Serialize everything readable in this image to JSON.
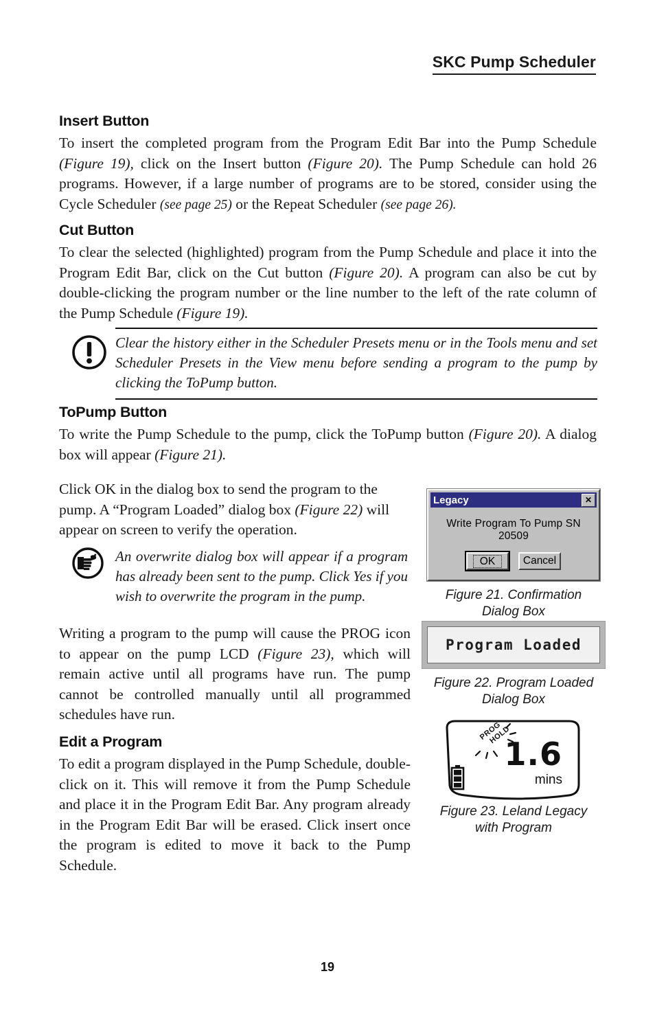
{
  "header": {
    "running_head": "SKC Pump Scheduler"
  },
  "sections": {
    "insert": {
      "heading": "Insert Button",
      "p1_a": "To insert the completed program from the Program Edit Bar into the Pump Schedule ",
      "p1_fig19": "(Figure 19),",
      "p1_b": " click on the Insert button ",
      "p1_fig20": "(Figure 20).",
      "p1_c": " The Pump Schedule can hold 26 programs. However, if a large number of programs are to be stored, consider using the Cycle Scheduler ",
      "p1_page25": "(see page 25)",
      "p1_d": " or the Repeat Scheduler ",
      "p1_page26": "(see page 26)."
    },
    "cut": {
      "heading": "Cut Button",
      "p1_a": "To clear the selected (highlighted) program from the Pump Schedule and place it into the Program Edit Bar, click on the Cut button ",
      "p1_fig20": "(Figure 20).",
      "p1_b": " A program can also be cut by double-clicking the program number or the line number to the left of the rate column of the Pump Schedule ",
      "p1_fig19": "(Figure 19)."
    },
    "warning_note": {
      "icon": "exclamation-circle-icon",
      "text": "Clear the history either in the Scheduler Presets menu or in the Tools menu and set Scheduler Presets in the View menu before sending a program to the pump by clicking the ToPump button."
    },
    "topump": {
      "heading": "ToPump Button",
      "p1_a": "To write the Pump Schedule to the pump, click the ToPump button ",
      "p1_fig20": "(Figure 20).",
      "p1_b": " A dialog box will appear ",
      "p1_fig21": "(Figure 21)."
    },
    "click_ok": {
      "p1_a": "Click OK in the dialog box to send the program to the pump. A “Program Loaded” dialog box ",
      "p1_fig22": "(Figure 22)",
      "p1_b": " will appear on screen to verify the operation."
    },
    "hand_note": {
      "icon": "pointing-hand-icon",
      "text": "An overwrite dialog box will appear if a program has already been sent to the pump. Click Yes if you wish to overwrite the program in the pump."
    },
    "prog_icon": {
      "p1_a": "Writing a program to the pump will cause the PROG icon to appear on the pump LCD ",
      "p1_fig23": "(Figure 23),",
      "p1_b": " which will remain active until all programs have run. The pump cannot be controlled manually until all programmed schedules have run."
    },
    "edit": {
      "heading": "Edit a Program",
      "p1": "To edit a program displayed in the Pump Schedule, double-click on it. This will remove it from the Pump Schedule and place it in the Program Edit Bar. Any program already in the Program Edit Bar will be erased. Click insert once the program is edited to move it back to the Pump Schedule."
    }
  },
  "figure21": {
    "dialog": {
      "title": "Legacy",
      "close_label": "✕",
      "message": "Write Program To Pump SN  20509",
      "ok_label": "OK",
      "cancel_label": "Cancel",
      "titlebar_color": "#2d2d82",
      "face_color": "#c0c0c0"
    },
    "caption_line1": "Figure 21. Confirmation",
    "caption_line2": "Dialog Box"
  },
  "figure22": {
    "message": "Program Loaded",
    "caption_line1": "Figure 22. Program Loaded",
    "caption_line2": "Dialog Box"
  },
  "figure23": {
    "lcd": {
      "indicator_prog": "PROG",
      "indicator_hold": "HOLD",
      "value": "1.6",
      "units": "mins",
      "battery_icon": "battery-icon"
    },
    "caption_line1": "Figure 23. Leland Legacy",
    "caption_line2": "with Program"
  },
  "footer": {
    "page_number": "19"
  }
}
